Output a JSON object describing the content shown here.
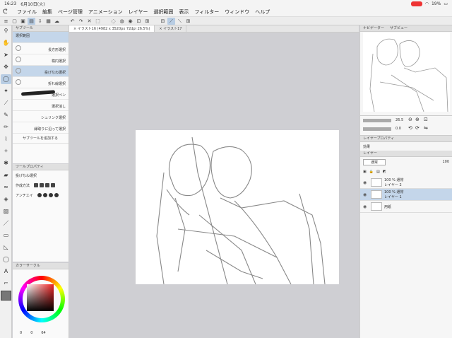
{
  "status": {
    "time": "16:23",
    "date": "6月10日(火)",
    "battery": "19%"
  },
  "menu": [
    "ファイル",
    "編集",
    "ページ管理",
    "アニメーション",
    "レイヤー",
    "選択範囲",
    "表示",
    "フィルター",
    "ウィンドウ",
    "ヘルプ"
  ],
  "doc_tabs": [
    {
      "label": "× イラスト16 (4982 x 3520px 72dpi 26.5%)"
    },
    {
      "label": "× イラスト17"
    }
  ],
  "sub_tool": {
    "title": "サブツール",
    "items": [
      "選択範囲",
      "長方形選択",
      "楕円選択",
      "投げなわ選択",
      "折れ線選択",
      "選択ペン",
      "選択消し",
      "シュリンク選択",
      "縁取りに沿って選択"
    ],
    "add_label": "サブツールを追加する"
  },
  "tool_property": {
    "title": "ツールプロパティ",
    "current": "投げなわ選択",
    "mode_label": "作成方法",
    "aa_label": "アンチエイ"
  },
  "color_panel": {
    "title": "カラーサークル",
    "values": [
      "0",
      "0",
      "64"
    ]
  },
  "navigator": {
    "tabs": [
      "ナビゲーター",
      "サブビュー"
    ],
    "zoom": "26.5",
    "angle": "0.0"
  },
  "layer_property": {
    "title": "レイヤープロパティ",
    "effect": "効果"
  },
  "layers": {
    "title": "レイヤー",
    "blend": "通常",
    "opacity": "100",
    "items": [
      {
        "pct": "100 %",
        "mode": "通常",
        "name": "レイヤー 2",
        "selected": false
      },
      {
        "pct": "100 %",
        "mode": "通常",
        "name": "レイヤー 1",
        "selected": true
      },
      {
        "pct": "",
        "mode": "",
        "name": "用紙",
        "selected": false
      }
    ]
  }
}
